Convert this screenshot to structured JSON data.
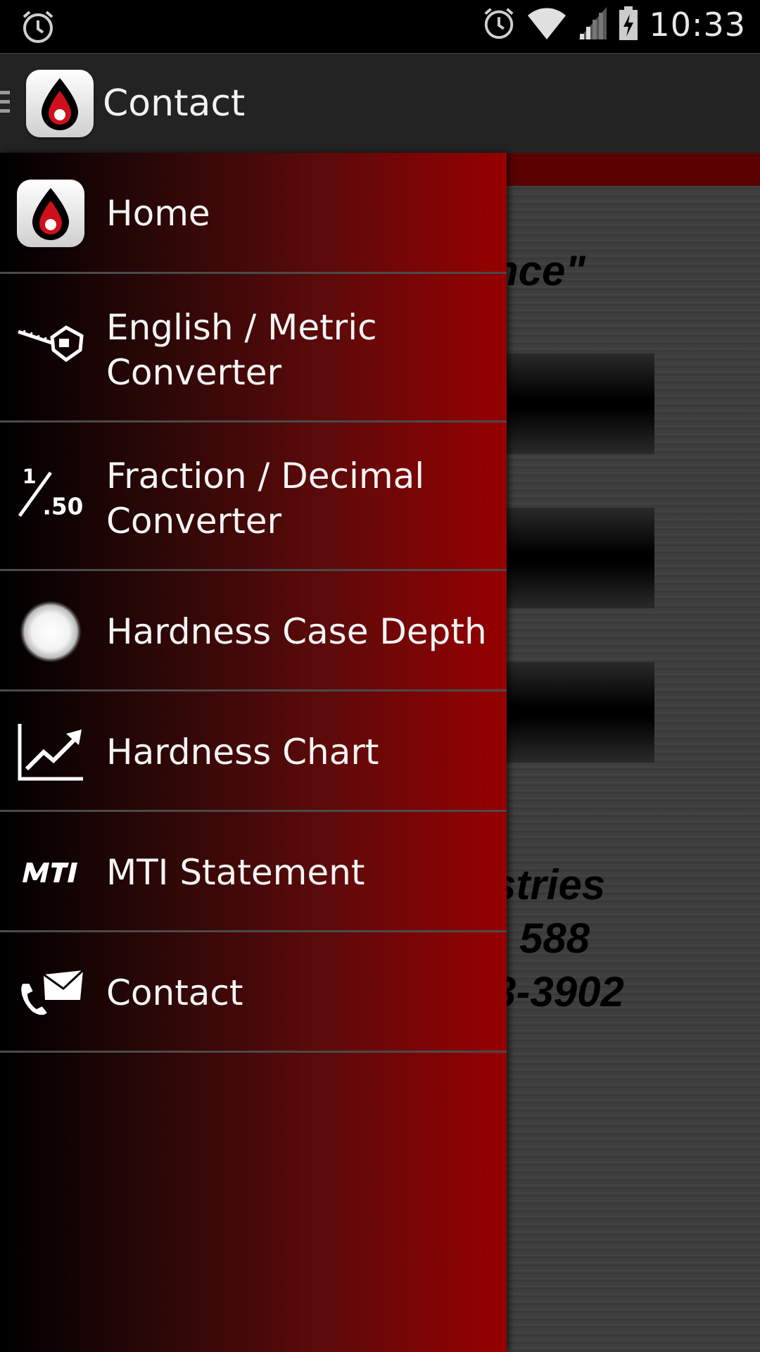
{
  "status_bar": {
    "time": "10:33",
    "icons": [
      "alarm-icon",
      "wifi-icon",
      "signal-icon",
      "battery-charging-icon"
    ]
  },
  "action_bar": {
    "title": "Contact",
    "icon": "app-logo-icon"
  },
  "drawer": {
    "items": [
      {
        "label": "Home",
        "icon": "app-logo-icon"
      },
      {
        "label": "English / Metric\nConverter",
        "icon": "tape-measure-icon"
      },
      {
        "label": "Fraction / Decimal\nConverter",
        "icon": "fraction-icon"
      },
      {
        "label": "Hardness Case Depth",
        "icon": "sphere-icon"
      },
      {
        "label": "Hardness Chart",
        "icon": "chart-trend-icon"
      },
      {
        "label": "MTI Statement",
        "icon": "mti-logo-icon"
      },
      {
        "label": "Contact",
        "icon": "phone-mail-icon"
      }
    ]
  },
  "background": {
    "quote_fragment": "nce\"",
    "company_fragment": "stries",
    "line2_fragment": "588",
    "phone_fragment": "3-3902"
  },
  "colors": {
    "drawer_gradient_end": "#960000",
    "action_bar": "#232323",
    "logo_red": "#d0101a"
  }
}
